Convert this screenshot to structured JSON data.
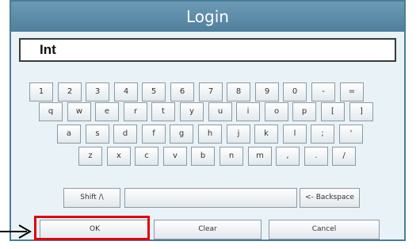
{
  "dialog": {
    "title": "Login",
    "entry_value": "Int"
  },
  "keyboard": {
    "rows": [
      [
        "1",
        "2",
        "3",
        "4",
        "5",
        "6",
        "7",
        "8",
        "9",
        "0",
        "-",
        "="
      ],
      [
        "q",
        "w",
        "e",
        "r",
        "t",
        "y",
        "u",
        "i",
        "o",
        "p",
        "[",
        "]"
      ],
      [
        "a",
        "s",
        "d",
        "f",
        "g",
        "h",
        "j",
        "k",
        "l",
        ";",
        "'"
      ],
      [
        "z",
        "x",
        "c",
        "v",
        "b",
        "n",
        "m",
        ",",
        ".",
        "/"
      ]
    ],
    "shift_label": "Shift /\\",
    "space_label": "",
    "backspace_label": "<- Backspace"
  },
  "actions": {
    "ok_label": "OK",
    "clear_label": "Clear",
    "cancel_label": "Cancel"
  },
  "annotation": {
    "highlight_color": "#e00010",
    "arrow_color": "#000000"
  }
}
